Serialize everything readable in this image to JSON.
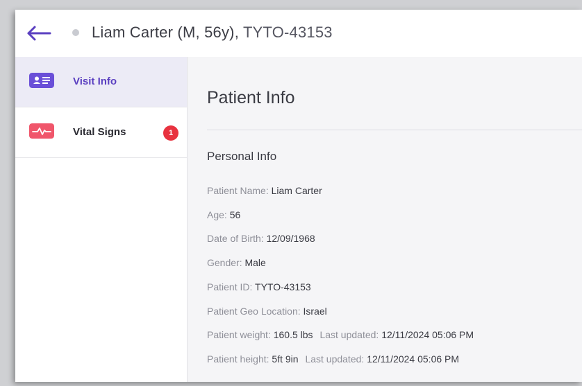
{
  "header": {
    "title": "Liam Carter (M, 56y)",
    "separator": ",",
    "patient_id": "TYTO-43153",
    "back_icon": "arrow-left-icon"
  },
  "sidebar": {
    "items": [
      {
        "label": "Visit Info",
        "icon": "id-card-icon",
        "icon_color": "#6a4fd8",
        "active": true
      },
      {
        "label": "Vital Signs",
        "icon": "heart-pulse-icon",
        "icon_color": "#f0566b",
        "badge": "1"
      }
    ]
  },
  "main": {
    "title": "Patient Info",
    "group_title": "Personal Info",
    "fields": [
      {
        "label": "Patient Name:",
        "value": "Liam Carter"
      },
      {
        "label": "Age:",
        "value": "56"
      },
      {
        "label": "Date of Birth:",
        "value": "12/09/1968"
      },
      {
        "label": "Gender:",
        "value": "Male"
      },
      {
        "label": "Patient ID:",
        "value": "TYTO-43153"
      },
      {
        "label": "Patient Geo Location:",
        "value": "Israel"
      },
      {
        "label": "Patient weight:",
        "value": "160.5 lbs",
        "label2": "Last updated:",
        "value2": "12/11/2024 05:06 PM"
      },
      {
        "label": "Patient height:",
        "value": "5ft 9in",
        "label2": "Last updated:",
        "value2": "12/11/2024 05:06 PM"
      }
    ]
  },
  "colors": {
    "accent": "#5a3fc0",
    "badge": "#e8323f"
  }
}
